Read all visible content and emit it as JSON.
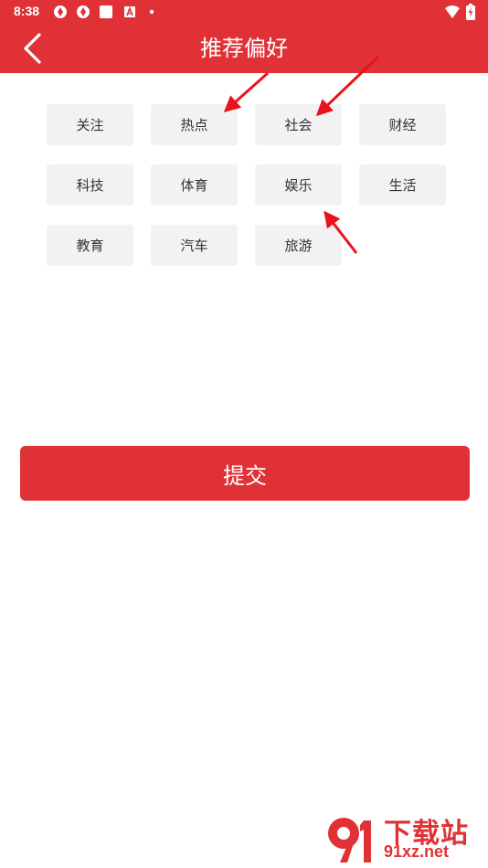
{
  "status_bar": {
    "time": "8:38",
    "icons": [
      "app-notification-icon",
      "app-notification-icon",
      "square-notification-icon",
      "a-notification-icon",
      "dot-icon",
      "wifi-icon",
      "battery-charging-icon"
    ]
  },
  "header": {
    "title": "推荐偏好",
    "back_icon": "chevron-left-icon",
    "background": "#e03236"
  },
  "tags": [
    {
      "label": "关注"
    },
    {
      "label": "热点"
    },
    {
      "label": "社会"
    },
    {
      "label": "财经"
    },
    {
      "label": "科技"
    },
    {
      "label": "体育"
    },
    {
      "label": "娱乐"
    },
    {
      "label": "生活"
    },
    {
      "label": "教育"
    },
    {
      "label": "汽车"
    },
    {
      "label": "旅游"
    }
  ],
  "submit": {
    "label": "提交"
  },
  "watermark": {
    "title": "下载站",
    "url": "91xz.net"
  },
  "colors": {
    "accent": "#e03236",
    "tag_background": "#f2f2f2",
    "annotation_arrow": "#e8141b"
  }
}
